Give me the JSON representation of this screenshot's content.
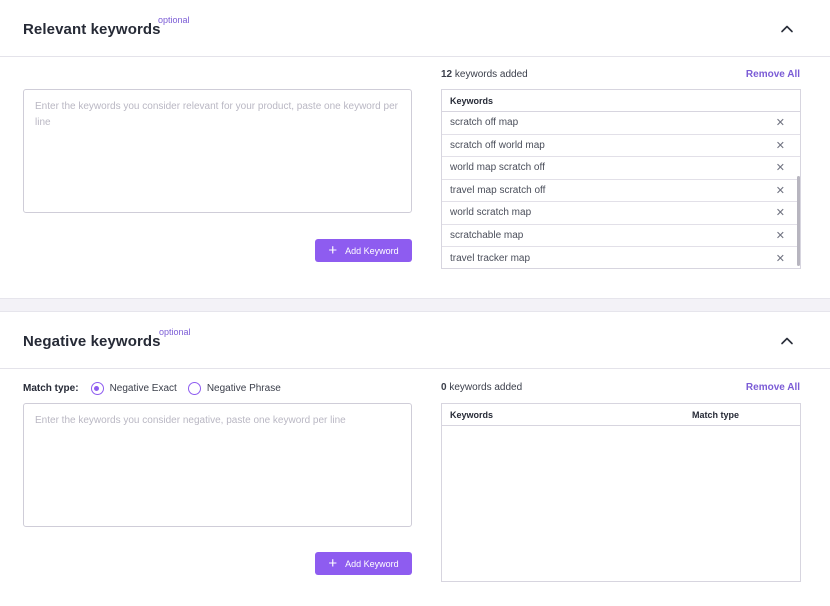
{
  "relevant": {
    "title": "Relevant keywords",
    "optional": "optional",
    "placeholder": "Enter the keywords you consider relevant for your product, paste one keyword per line",
    "add_button": "Add Keyword",
    "count": "12",
    "count_suffix": "keywords added",
    "remove_all": "Remove All",
    "table_header": "Keywords",
    "keywords": [
      "scratch off map",
      "scratch off world map",
      "world map scratch off",
      "travel map scratch off",
      "world scratch map",
      "scratchable map",
      "travel tracker map"
    ]
  },
  "negative": {
    "title": "Negative keywords",
    "optional": "optional",
    "match_type_label": "Match type:",
    "option_exact": "Negative Exact",
    "option_phrase": "Negative Phrase",
    "selected": "Negative Exact",
    "placeholder": "Enter the keywords you consider negative, paste one keyword per line",
    "add_button": "Add Keyword",
    "count": "0",
    "count_suffix": "keywords added",
    "remove_all": "Remove All",
    "col_keywords": "Keywords",
    "col_match": "Match type"
  },
  "icons": {
    "collapse": "chevron-up-icon",
    "remove": "close-icon",
    "add": "plus-icon"
  },
  "colors": {
    "accent": "#8e5cf0",
    "link": "#7b5cd6"
  }
}
